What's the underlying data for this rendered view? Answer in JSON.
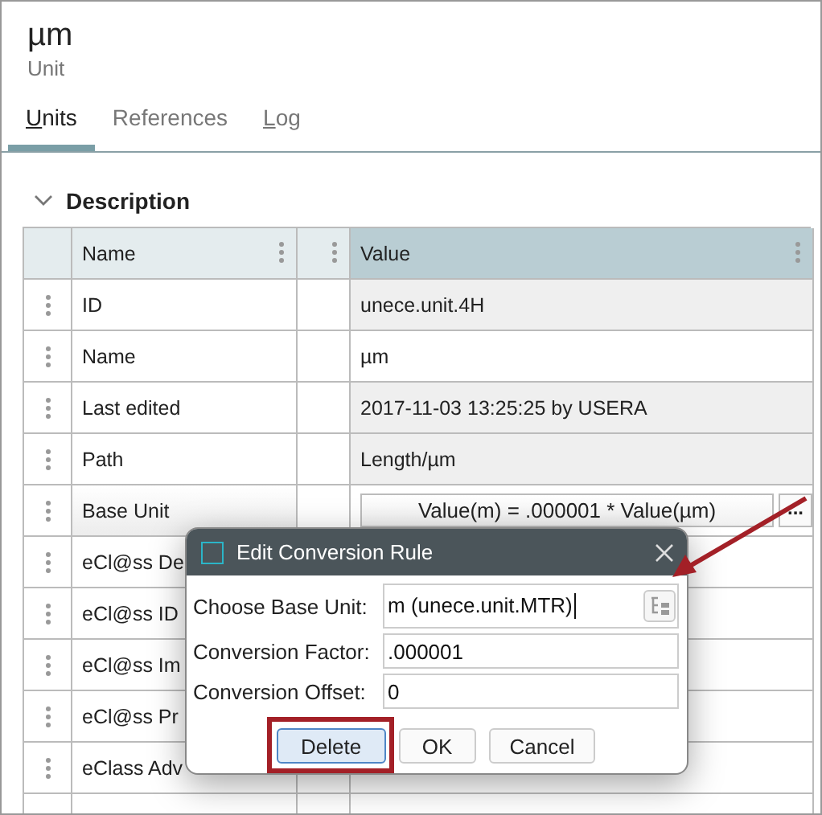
{
  "header": {
    "title": "µm",
    "subtitle": "Unit"
  },
  "tabs": [
    {
      "label": "Units",
      "selected": true,
      "underlined": true
    },
    {
      "label": "References",
      "selected": false,
      "underlined": false
    },
    {
      "label": "Log",
      "selected": false,
      "underlined": true
    }
  ],
  "section": {
    "title": "Description",
    "expanded": true
  },
  "table": {
    "columns": [
      {
        "label": "Name",
        "highlighted": false
      },
      {
        "label": "Value",
        "highlighted": true
      }
    ],
    "rows": [
      {
        "name": "ID",
        "value": "unece.unit.4H",
        "readonly": true,
        "kind": "text"
      },
      {
        "name": "Name",
        "value": "µm",
        "readonly": false,
        "kind": "text"
      },
      {
        "name": "Last edited",
        "value": "2017-11-03 13:25:25 by USERA",
        "readonly": true,
        "kind": "text"
      },
      {
        "name": "Path",
        "value": "Length/µm",
        "readonly": true,
        "kind": "text"
      },
      {
        "name": "Base Unit",
        "value": "Value(m) = .000001 * Value(µm)",
        "readonly": false,
        "kind": "formula",
        "button": "..."
      },
      {
        "name": "eCl@ss De",
        "readonly": false,
        "kind": "text"
      },
      {
        "name": "eCl@ss ID",
        "readonly": false,
        "kind": "text"
      },
      {
        "name": "eCl@ss Im",
        "readonly": false,
        "kind": "text"
      },
      {
        "name": "eCl@ss Pr",
        "readonly": false,
        "kind": "text"
      },
      {
        "name": "eClass Adv",
        "readonly": false,
        "kind": "text"
      }
    ]
  },
  "dialog": {
    "title": "Edit Conversion Rule",
    "fields": [
      {
        "label": "Choose Base Unit:",
        "value": "m (unece.unit.MTR)",
        "kind": "picker",
        "focused": true
      },
      {
        "label": "Conversion Factor:",
        "value": ".000001",
        "kind": "text",
        "focused": false
      },
      {
        "label": "Conversion Offset:",
        "value": "0",
        "kind": "text",
        "focused": false
      }
    ],
    "buttons": [
      {
        "label": "Delete",
        "focused": true,
        "highlighted": true
      },
      {
        "label": "OK",
        "focused": false,
        "highlighted": false
      },
      {
        "label": "Cancel",
        "focused": false,
        "highlighted": false
      }
    ]
  }
}
